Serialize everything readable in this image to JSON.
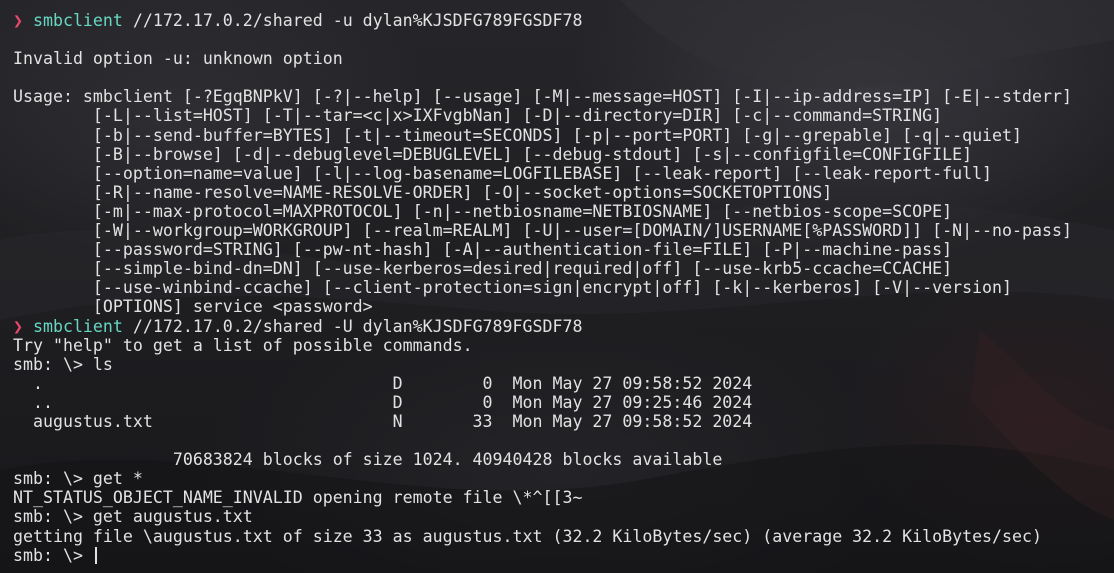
{
  "colors": {
    "prompt_arrow": "#e8496a",
    "command": "#67d7c4",
    "text": "#e2e2e2"
  },
  "prompt_symbol": "❯",
  "lines": [
    {
      "kind": "prompt",
      "cmd": "smbclient",
      "args": " //172.17.0.2/shared -u dylan%KJSDFG789FGSDF78"
    },
    {
      "kind": "blank"
    },
    {
      "kind": "out",
      "text": "Invalid option -u: unknown option"
    },
    {
      "kind": "blank"
    },
    {
      "kind": "out",
      "text": "Usage: smbclient [-?EgqBNPkV] [-?|--help] [--usage] [-M|--message=HOST] [-I|--ip-address=IP] [-E|--stderr]"
    },
    {
      "kind": "out",
      "text": "        [-L|--list=HOST] [-T|--tar=<c|x>IXFvgbNan] [-D|--directory=DIR] [-c|--command=STRING]"
    },
    {
      "kind": "out",
      "text": "        [-b|--send-buffer=BYTES] [-t|--timeout=SECONDS] [-p|--port=PORT] [-g|--grepable] [-q|--quiet]"
    },
    {
      "kind": "out",
      "text": "        [-B|--browse] [-d|--debuglevel=DEBUGLEVEL] [--debug-stdout] [-s|--configfile=CONFIGFILE]"
    },
    {
      "kind": "out",
      "text": "        [--option=name=value] [-l|--log-basename=LOGFILEBASE] [--leak-report] [--leak-report-full]"
    },
    {
      "kind": "out",
      "text": "        [-R|--name-resolve=NAME-RESOLVE-ORDER] [-O|--socket-options=SOCKETOPTIONS]"
    },
    {
      "kind": "out",
      "text": "        [-m|--max-protocol=MAXPROTOCOL] [-n|--netbiosname=NETBIOSNAME] [--netbios-scope=SCOPE]"
    },
    {
      "kind": "out",
      "text": "        [-W|--workgroup=WORKGROUP] [--realm=REALM] [-U|--user=[DOMAIN/]USERNAME[%PASSWORD]] [-N|--no-pass]"
    },
    {
      "kind": "out",
      "text": "        [--password=STRING] [--pw-nt-hash] [-A|--authentication-file=FILE] [-P|--machine-pass]"
    },
    {
      "kind": "out",
      "text": "        [--simple-bind-dn=DN] [--use-kerberos=desired|required|off] [--use-krb5-ccache=CCACHE]"
    },
    {
      "kind": "out",
      "text": "        [--use-winbind-ccache] [--client-protection=sign|encrypt|off] [-k|--kerberos] [-V|--version]"
    },
    {
      "kind": "out",
      "text": "        [OPTIONS] service <password>"
    },
    {
      "kind": "prompt",
      "cmd": "smbclient",
      "args": " //172.17.0.2/shared -U dylan%KJSDFG789FGSDF78"
    },
    {
      "kind": "out",
      "text": "Try \"help\" to get a list of possible commands."
    },
    {
      "kind": "out",
      "text": "smb: \\> ls"
    },
    {
      "kind": "out",
      "text": "  .                                   D        0  Mon May 27 09:58:52 2024"
    },
    {
      "kind": "out",
      "text": "  ..                                  D        0  Mon May 27 09:25:46 2024"
    },
    {
      "kind": "out",
      "text": "  augustus.txt                        N       33  Mon May 27 09:58:52 2024"
    },
    {
      "kind": "blank"
    },
    {
      "kind": "out",
      "text": "                70683824 blocks of size 1024. 40940428 blocks available"
    },
    {
      "kind": "out",
      "text": "smb: \\> get *"
    },
    {
      "kind": "out",
      "text": "NT_STATUS_OBJECT_NAME_INVALID opening remote file \\*^[[3~"
    },
    {
      "kind": "out",
      "text": "smb: \\> get augustus.txt"
    },
    {
      "kind": "out",
      "text": "getting file \\augustus.txt of size 33 as augustus.txt (32.2 KiloBytes/sec) (average 32.2 KiloBytes/sec)"
    },
    {
      "kind": "cursorline",
      "text": "smb: \\> "
    }
  ]
}
